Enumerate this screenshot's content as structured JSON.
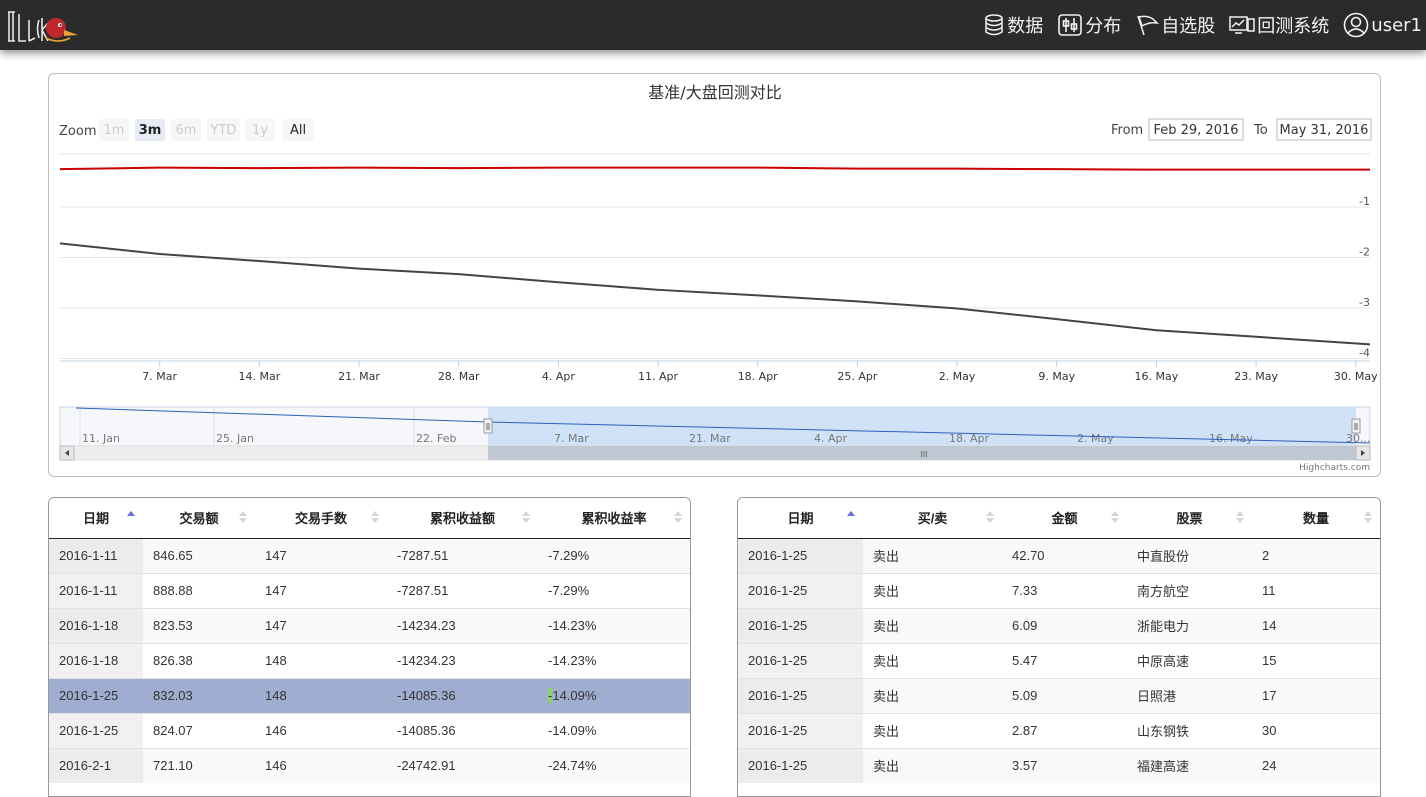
{
  "nav": {
    "items": [
      {
        "label": "数据",
        "icon": "database-icon"
      },
      {
        "label": "分布",
        "icon": "sliders-icon"
      },
      {
        "label": "自选股",
        "icon": "flag-icon"
      },
      {
        "label": "回测系统",
        "icon": "monitor-chart-icon"
      },
      {
        "label": "user1",
        "icon": "user-icon"
      }
    ]
  },
  "chart": {
    "title": "基准/大盘回测对比",
    "zoom_label": "Zoom",
    "zoom_buttons": [
      "1m",
      "3m",
      "6m",
      "YTD",
      "1y",
      "All"
    ],
    "zoom_active": "3m",
    "zoom_disabled": [
      "1m",
      "6m",
      "YTD",
      "1y"
    ],
    "from_label": "From",
    "from_value": "Feb 29, 2016",
    "to_label": "To",
    "to_value": "May 31, 2016",
    "credits": "Highcharts.com",
    "colors": {
      "series_red": "#cc0000",
      "series_dark": "#444444",
      "navigator_line": "#2f5fbf",
      "navigator_fill": "#c7dcf6"
    },
    "y_ticks": [
      "-1",
      "-2",
      "-3",
      "-4"
    ],
    "x_ticks": [
      "7. Mar",
      "14. Mar",
      "21. Mar",
      "28. Mar",
      "4. Apr",
      "11. Apr",
      "18. Apr",
      "25. Apr",
      "2. May",
      "9. May",
      "16. May",
      "23. May",
      "30. May"
    ],
    "navigator_ticks": [
      "11. Jan",
      "25. Jan",
      "22. Feb",
      "7. Mar",
      "21. Mar",
      "4. Apr",
      "18. Apr",
      "2. May",
      "16. May",
      "30..."
    ],
    "scrollbar_grip": "III"
  },
  "chart_data": {
    "type": "line",
    "title": "基准/大盘回测对比",
    "x": [
      "2016-02-29",
      "2016-03-07",
      "2016-03-14",
      "2016-03-21",
      "2016-03-28",
      "2016-04-04",
      "2016-04-11",
      "2016-04-18",
      "2016-04-25",
      "2016-05-02",
      "2016-05-09",
      "2016-05-16",
      "2016-05-23",
      "2016-05-31"
    ],
    "series": [
      {
        "values": [
          -0.25,
          -0.22,
          -0.23,
          -0.22,
          -0.23,
          -0.22,
          -0.22,
          -0.22,
          -0.24,
          -0.24,
          -0.25,
          -0.26,
          -0.26,
          -0.26
        ]
      },
      {
        "values": [
          -1.72,
          -1.93,
          -2.07,
          -2.22,
          -2.33,
          -2.49,
          -2.64,
          -2.75,
          -2.87,
          -3.01,
          -3.22,
          -3.44,
          -3.57,
          -3.72
        ]
      }
    ],
    "ylim": [
      -4.05,
      0.05
    ],
    "y_ticks": [
      -1,
      -2,
      -3,
      -4
    ],
    "grid": true,
    "legend": "none"
  },
  "table_left": {
    "columns": [
      "日期",
      "交易额",
      "交易手数",
      "累积收益额",
      "累积收益率"
    ],
    "sorted_column": 0,
    "selected_row": 4,
    "rows": [
      [
        "2016-1-11",
        "846.65",
        "147",
        "-7287.51",
        "-7.29%"
      ],
      [
        "2016-1-11",
        "888.88",
        "147",
        "-7287.51",
        "-7.29%"
      ],
      [
        "2016-1-18",
        "823.53",
        "147",
        "-14234.23",
        "-14.23%"
      ],
      [
        "2016-1-18",
        "826.38",
        "148",
        "-14234.23",
        "-14.23%"
      ],
      [
        "2016-1-25",
        "832.03",
        "148",
        "-14085.36",
        "-14.09%"
      ],
      [
        "2016-1-25",
        "824.07",
        "146",
        "-14085.36",
        "-14.09%"
      ],
      [
        "2016-2-1",
        "721.10",
        "146",
        "-24742.91",
        "-24.74%"
      ]
    ]
  },
  "table_right": {
    "columns": [
      "日期",
      "买/卖",
      "金额",
      "股票",
      "数量"
    ],
    "sorted_column": 0,
    "rows": [
      [
        "2016-1-25",
        "卖出",
        "42.70",
        "中直股份",
        "2"
      ],
      [
        "2016-1-25",
        "卖出",
        "7.33",
        "南方航空",
        "11"
      ],
      [
        "2016-1-25",
        "卖出",
        "6.09",
        "浙能电力",
        "14"
      ],
      [
        "2016-1-25",
        "卖出",
        "5.47",
        "中原高速",
        "15"
      ],
      [
        "2016-1-25",
        "卖出",
        "5.09",
        "日照港",
        "17"
      ],
      [
        "2016-1-25",
        "卖出",
        "2.87",
        "山东钢铁",
        "30"
      ],
      [
        "2016-1-25",
        "卖出",
        "3.57",
        "福建高速",
        "24"
      ]
    ]
  }
}
